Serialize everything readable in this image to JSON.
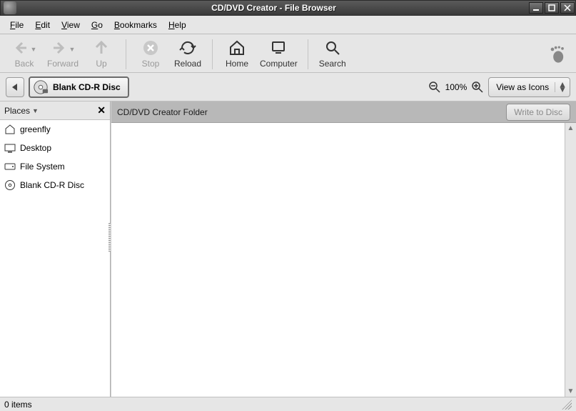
{
  "window": {
    "title": "CD/DVD Creator - File Browser"
  },
  "menu": {
    "file": "File",
    "edit": "Edit",
    "view": "View",
    "go": "Go",
    "bookmarks": "Bookmarks",
    "help": "Help"
  },
  "toolbar": {
    "back": "Back",
    "forward": "Forward",
    "up": "Up",
    "stop": "Stop",
    "reload": "Reload",
    "home": "Home",
    "computer": "Computer",
    "search": "Search"
  },
  "location": {
    "current": "Blank CD-R Disc",
    "zoom": "100%",
    "view_mode": "View as Icons"
  },
  "sidebar": {
    "header": "Places",
    "items": [
      {
        "label": "greenfly"
      },
      {
        "label": "Desktop"
      },
      {
        "label": "File System"
      },
      {
        "label": "Blank CD-R Disc"
      }
    ]
  },
  "main": {
    "header": "CD/DVD Creator Folder",
    "write_btn": "Write to Disc"
  },
  "status": {
    "text": "0 items"
  }
}
